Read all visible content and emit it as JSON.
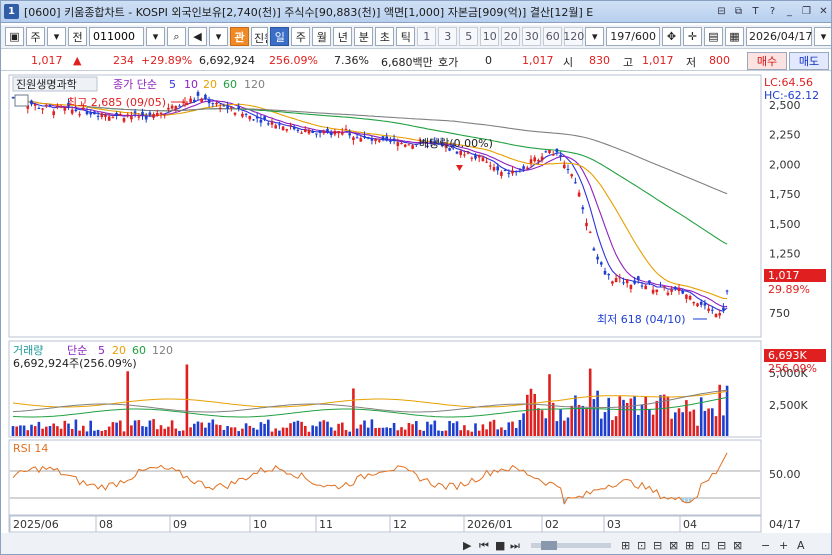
{
  "titlebar": {
    "window_number": "1",
    "text": "[0600] 키움종합차트 - KOSPI 외국인보유[2,740(천)] 주식수[90,883(천)] 액면[1,000] 자본금[909(억)] 결산[12월] E"
  },
  "toolbar": {
    "market": "주",
    "period_all": "전",
    "code": "011000",
    "stock_name": "진원생명과",
    "stock_tag": "관",
    "periods": [
      "일",
      "주",
      "월",
      "년",
      "분",
      "초",
      "틱"
    ],
    "active_period": "일",
    "minutes": [
      "1",
      "3",
      "5",
      "10",
      "20",
      "30",
      "60",
      "120"
    ],
    "count": "197/600",
    "date": "2026/04/17"
  },
  "quote": {
    "price": "1,017",
    "change": "234",
    "change_pct": "+29.89%",
    "volume": "6,692,924",
    "volume_pct": "256.09%",
    "turnover_pct": "7.36%",
    "amount": "6,680백만",
    "hoga_label": "호가",
    "hoga_value": "0",
    "open_value": "1,017",
    "open_label": "시",
    "open_price": "830",
    "high_label": "고",
    "high_price": "1,017",
    "low_label": "저",
    "low_price": "800",
    "buy_label": "매수",
    "sell_label": "매도"
  },
  "price_panel": {
    "legend_name": "진원생명과학",
    "legend_ma": "종가 단순",
    "ma_periods": [
      "5",
      "10",
      "20",
      "60",
      "120"
    ],
    "lc_label": "LC:64.56",
    "hc_label": "HC:-62.12",
    "high_note": "최고 2,685 (09/05)",
    "dividend_note": "배당락(0.00%)",
    "low_note": "최저 618 (04/10)",
    "last_price_tag": "1,017",
    "last_pct_tag": "29.89%",
    "y_ticks": [
      "2,500",
      "2,250",
      "2,000",
      "1,750",
      "1,500",
      "1,250",
      "1,000",
      "750"
    ]
  },
  "volume_panel": {
    "legend_name": "거래량",
    "legend_ma": "단순",
    "ma_periods": [
      "5",
      "20",
      "60",
      "120"
    ],
    "value_line": "6,692,924주(256.09%)",
    "last_tag": "6,693K",
    "last_pct": "256.09%",
    "y_ticks": [
      "5,000K",
      "2,500K"
    ]
  },
  "rsi_panel": {
    "legend": "RSI 14",
    "y_ticks": [
      "50.00"
    ]
  },
  "x_axis": {
    "labels": [
      "2025/06",
      "08",
      "09",
      "10",
      "11",
      "12",
      "2026/01",
      "02",
      "03",
      "04"
    ],
    "right_label": "04/17"
  },
  "colors": {
    "up": "#e02020",
    "down": "#1d3fd0",
    "ma5": "#3030e0",
    "ma10": "#9020c0",
    "ma20": "#e8a000",
    "ma60": "#20a040",
    "ma120": "#808080"
  }
}
